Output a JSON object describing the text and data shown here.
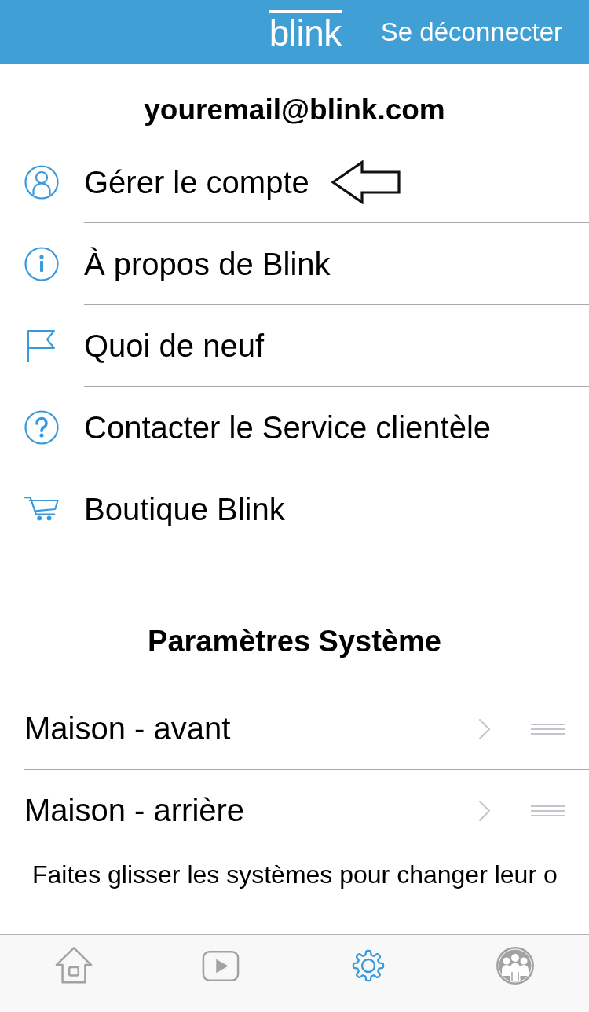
{
  "header": {
    "logo": "blink",
    "logout": "Se déconnecter"
  },
  "account": {
    "email": "youremail@blink.com"
  },
  "menu": [
    {
      "kind": "account",
      "label": "Gérer le compte",
      "arrow_marked": true
    },
    {
      "kind": "info",
      "label": "À propos de Blink",
      "arrow_marked": false
    },
    {
      "kind": "news",
      "label": "Quoi de neuf",
      "arrow_marked": false
    },
    {
      "kind": "support",
      "label": "Contacter le Service clientèle",
      "arrow_marked": false
    },
    {
      "kind": "shop",
      "label": "Boutique Blink",
      "arrow_marked": false
    }
  ],
  "systems": {
    "title": "Paramètres Système",
    "rows": [
      {
        "name": "Maison - avant"
      },
      {
        "name": "Maison - arrière"
      }
    ],
    "hint": "Faites glisser les systèmes pour changer leur o"
  },
  "tab_bar": [
    {
      "kind": "home",
      "selected": false
    },
    {
      "kind": "clips",
      "selected": false
    },
    {
      "kind": "settings",
      "selected": true
    },
    {
      "kind": "people",
      "selected": false
    }
  ]
}
